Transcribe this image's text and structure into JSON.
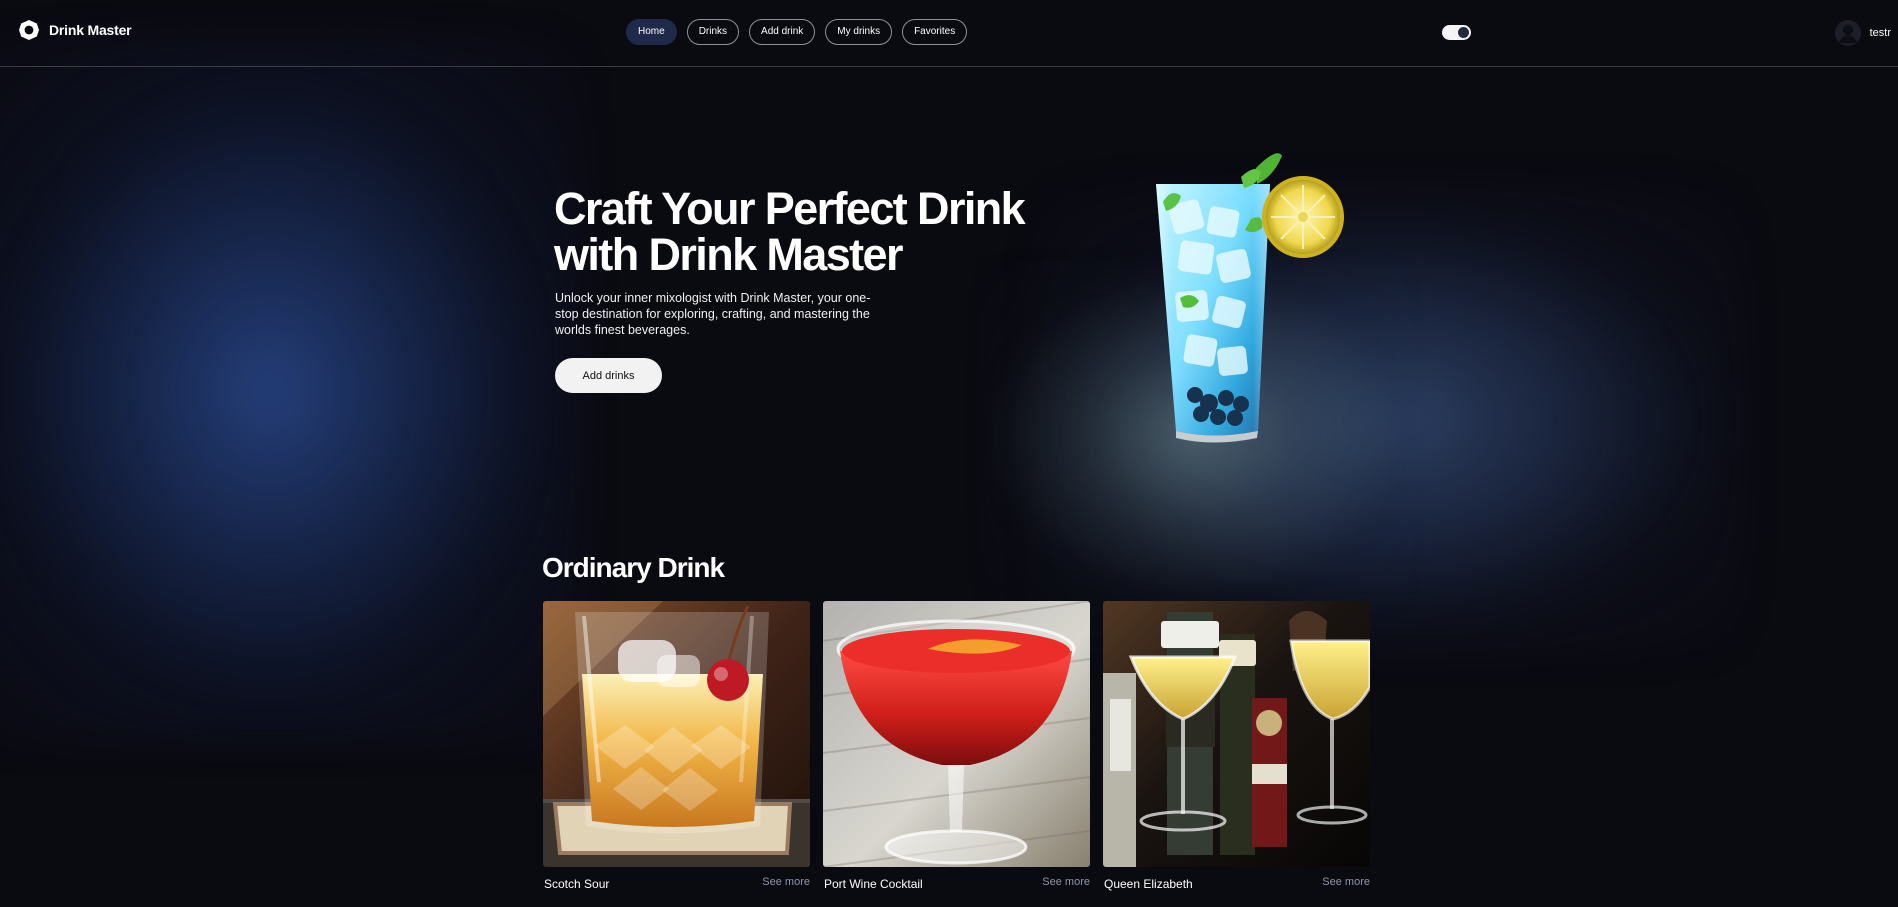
{
  "app": {
    "name": "Drink Master"
  },
  "nav": {
    "items": [
      {
        "label": "Home",
        "active": true
      },
      {
        "label": "Drinks",
        "active": false
      },
      {
        "label": "Add drink",
        "active": false
      },
      {
        "label": "My drinks",
        "active": false
      },
      {
        "label": "Favorites",
        "active": false
      }
    ]
  },
  "header": {
    "theme_toggle": {
      "icon": "toggle-icon",
      "state": "on"
    },
    "user": {
      "name": "testr",
      "avatar_icon": "user-avatar-icon"
    }
  },
  "hero": {
    "title": "Craft Your Perfect Drink with Drink Master",
    "description": "Unlock your inner mixologist with Drink Master, your one-stop destination for exploring, crafting, and mastering the worlds finest beverages.",
    "cta_label": "Add drinks"
  },
  "section": {
    "title": "Ordinary Drink"
  },
  "drinks": [
    {
      "name": "Scotch Sour",
      "link_label": "See more"
    },
    {
      "name": "Port Wine Cocktail",
      "link_label": "See more"
    },
    {
      "name": "Queen Elizabeth",
      "link_label": "See more"
    }
  ],
  "colors": {
    "background": "#0a0a11",
    "nav_active": "#1f2a4a",
    "accent_blue": "#2b4d91",
    "text_primary": "#ffffff",
    "text_muted": "#8f95a8",
    "button_bg": "#f2f2f2"
  }
}
